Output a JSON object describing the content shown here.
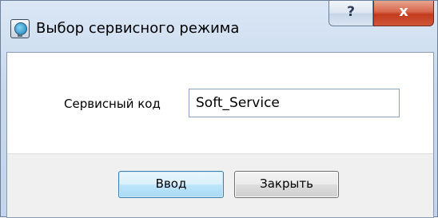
{
  "window": {
    "title": "Выбор сервисного режима",
    "help_glyph": "?",
    "close_glyph": "x"
  },
  "form": {
    "service_code_label": "Сервисный код",
    "service_code_value": "Soft_Service"
  },
  "buttons": {
    "enter_label": "Ввод",
    "close_label": "Закрыть"
  },
  "icons": {
    "app": "monitor-settings-icon",
    "help": "help-icon",
    "close": "close-icon"
  }
}
